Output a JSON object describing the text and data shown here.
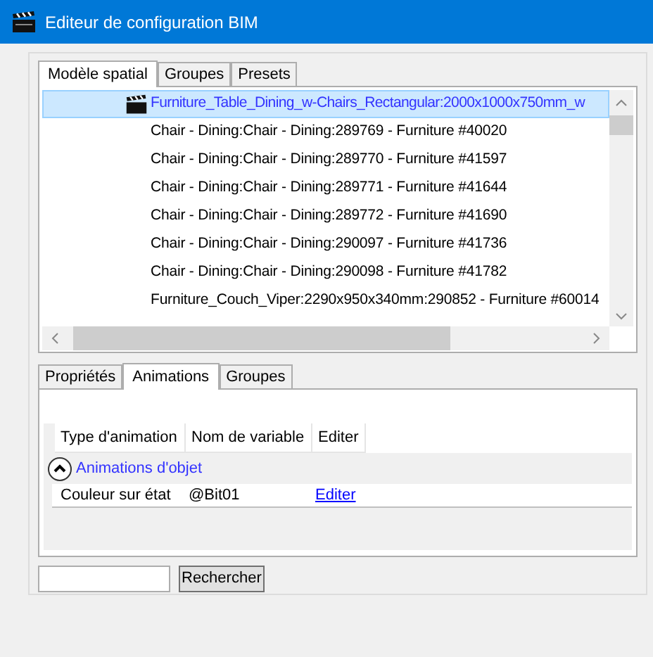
{
  "window": {
    "title": "Editeur de configuration BIM"
  },
  "top_tabs": [
    {
      "label": "Modèle spatial",
      "selected": true
    },
    {
      "label": "Groupes",
      "selected": false
    },
    {
      "label": "Presets",
      "selected": false
    }
  ],
  "tree_items": [
    {
      "label": "Furniture_Table_Dining_w-Chairs_Rectangular:2000x1000x750mm_w",
      "selected": true,
      "kind": "group"
    },
    {
      "label": "Chair - Dining:Chair - Dining:289769 - Furniture #40020",
      "selected": false,
      "kind": "item"
    },
    {
      "label": "Chair - Dining:Chair - Dining:289770 - Furniture #41597",
      "selected": false,
      "kind": "item"
    },
    {
      "label": "Chair - Dining:Chair - Dining:289771 - Furniture #41644",
      "selected": false,
      "kind": "item"
    },
    {
      "label": "Chair - Dining:Chair - Dining:289772 - Furniture #41690",
      "selected": false,
      "kind": "item"
    },
    {
      "label": "Chair - Dining:Chair - Dining:290097 - Furniture #41736",
      "selected": false,
      "kind": "item"
    },
    {
      "label": "Chair - Dining:Chair - Dining:290098 - Furniture #41782",
      "selected": false,
      "kind": "item"
    },
    {
      "label": "Furniture_Couch_Viper:2290x950x340mm:290852 - Furniture #60014",
      "selected": false,
      "kind": "item"
    }
  ],
  "bottom_tabs": [
    {
      "label": "Propriétés",
      "selected": false
    },
    {
      "label": "Animations",
      "selected": true
    },
    {
      "label": "Groupes",
      "selected": false
    }
  ],
  "grid": {
    "columns": [
      "Type d'animation",
      "Nom de variable",
      "Editer"
    ],
    "group": {
      "label": "Animations d'objet",
      "expanded": true
    },
    "rows": [
      {
        "type": "Couleur sur état",
        "variable": "@Bit01",
        "action": "Editer"
      }
    ]
  },
  "search": {
    "button": "Rechercher"
  }
}
